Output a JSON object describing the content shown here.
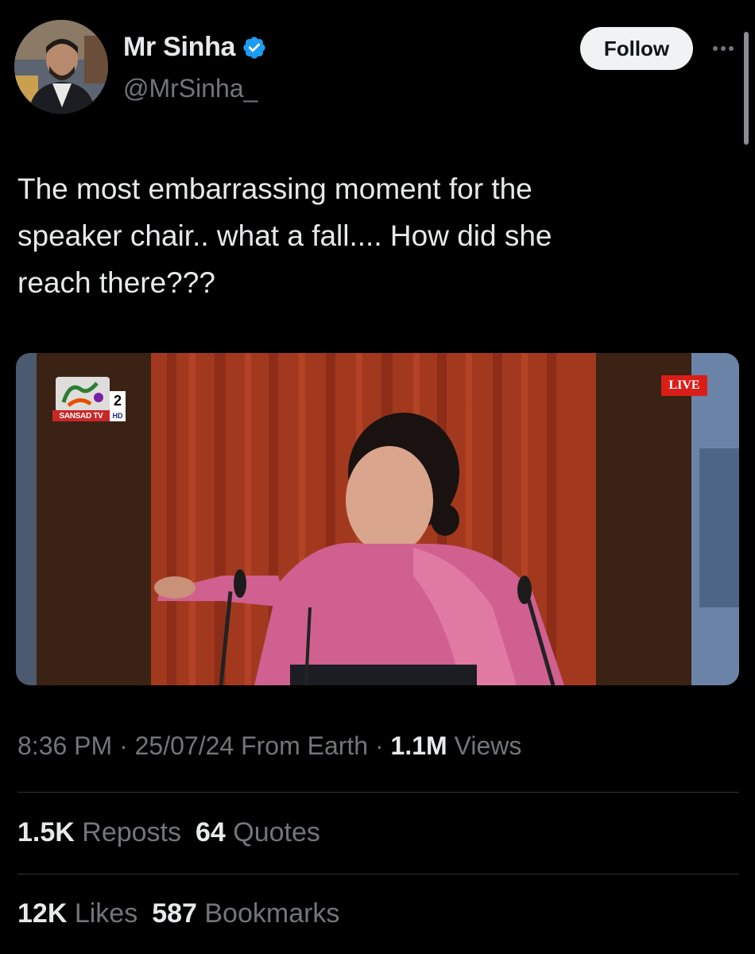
{
  "user": {
    "display_name": "Mr Sinha",
    "handle": "@MrSinha_",
    "verified": true,
    "verified_color": "#1d9bf0"
  },
  "header": {
    "follow_label": "Follow",
    "more_icon": "more-horizontal-icon"
  },
  "tweet": {
    "text": "The most embarrassing moment for the\nspeaker chair.. what a fall.... How did she\nreach there???"
  },
  "media": {
    "live_label": "LIVE",
    "channel_name": "SANSAD TV",
    "channel_number": "2",
    "channel_hd": "HD"
  },
  "meta": {
    "time": "8:36 PM",
    "separator": " · ",
    "date": "25/07/24",
    "source": " From Earth",
    "views_count": "1.1M",
    "views_label": " Views"
  },
  "engagement": {
    "reposts_count": "1.5K",
    "reposts_label": " Reposts",
    "quotes_count": "64",
    "quotes_label": " Quotes",
    "likes_count": "12K",
    "likes_label": " Likes",
    "bookmarks_count": "587",
    "bookmarks_label": " Bookmarks"
  }
}
